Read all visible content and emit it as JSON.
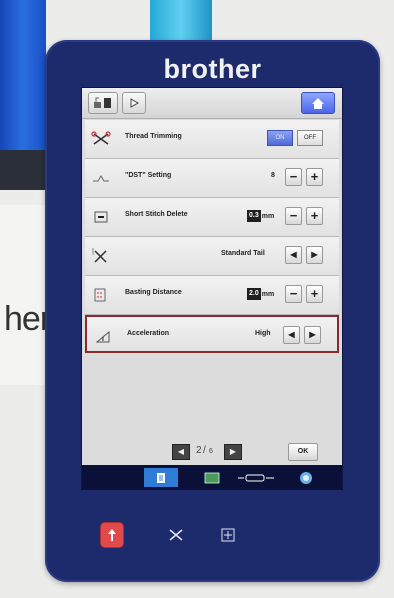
{
  "device": {
    "brand": "brother"
  },
  "rows": [
    {
      "label": "Thread Trimming",
      "on_label": "ON",
      "off_label": "OFF"
    },
    {
      "label": "\"DST\" Setting",
      "value": "8",
      "minus": "−",
      "plus": "+"
    },
    {
      "label": "Short Stitch Delete",
      "value": "0.3",
      "unit": "mm",
      "minus": "−",
      "plus": "+"
    },
    {
      "label": "",
      "value": "Standard Tail",
      "left": "◀",
      "right": "▶"
    },
    {
      "label": "Basting Distance",
      "value": "2.0",
      "unit": "mm",
      "minus": "−",
      "plus": "+"
    },
    {
      "label": "Acceleration",
      "value": "High",
      "left": "◀",
      "right": "▶"
    }
  ],
  "pager": {
    "current": "2",
    "sep": "/",
    "total": "6",
    "prev": "◀",
    "next": "▶",
    "ok": "OK"
  },
  "icons": {
    "home": "home-icon",
    "settings_a": "machine-settings-icon",
    "settings_b": "display-settings-icon",
    "thread_trim": "scissors-icon",
    "dst": "dst-icon",
    "short_stitch": "stitch-delete-icon",
    "tail": "scissors-tail-icon",
    "basting": "basting-icon",
    "accel": "acceleration-icon"
  },
  "colors": {
    "bezel": "#1d2a6b",
    "accent": "#4e68d6",
    "selected_outline": "#8a2a30",
    "start_stop": "#e04a4a"
  }
}
